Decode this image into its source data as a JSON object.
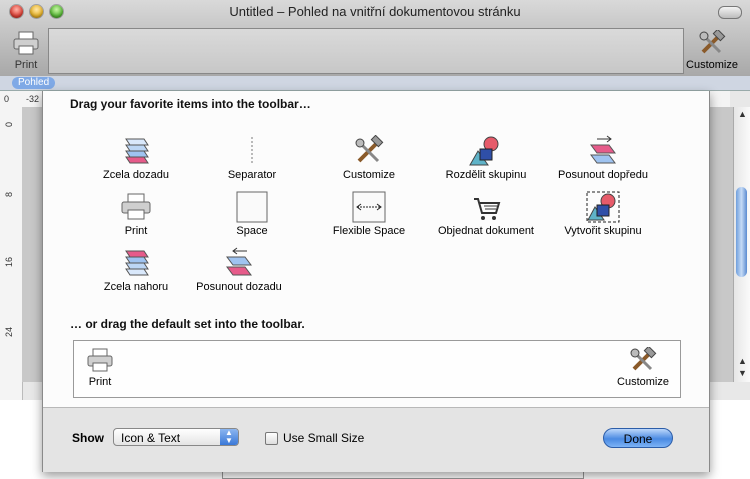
{
  "window": {
    "title": "Untitled – Pohled na vnitřní dokumentovou stránku",
    "toolbar": {
      "print_label": "Print",
      "customize_label": "Customize"
    },
    "doc_tab": "Pohled",
    "ruler": {
      "top_value": "-32",
      "top_value2": "0",
      "left_marks": [
        "0",
        "8",
        "16",
        "24"
      ]
    }
  },
  "sheet": {
    "heading": "Drag your favorite items into the toolbar…",
    "items": [
      {
        "label": "Zcela dozadu",
        "icon": "send-to-back-icon"
      },
      {
        "label": "Separator",
        "icon": "separator-icon"
      },
      {
        "label": "Customize",
        "icon": "customize-tools-icon"
      },
      {
        "label": "Rozdělit skupinu",
        "icon": "ungroup-icon"
      },
      {
        "label": "Posunout dopředu",
        "icon": "bring-forward-icon"
      },
      {
        "label": "Print",
        "icon": "printer-icon"
      },
      {
        "label": "Space",
        "icon": "space-icon"
      },
      {
        "label": "Flexible Space",
        "icon": "flexible-space-icon"
      },
      {
        "label": "Objednat dokument",
        "icon": "shopping-cart-icon"
      },
      {
        "label": "Vytvořit skupinu",
        "icon": "group-icon"
      },
      {
        "label": "Zcela nahoru",
        "icon": "bring-to-front-icon"
      },
      {
        "label": "Posunout dozadu",
        "icon": "send-backward-icon"
      }
    ],
    "default_heading": "… or drag the default set into the toolbar.",
    "default_set": {
      "print_label": "Print",
      "customize_label": "Customize"
    },
    "bottom": {
      "show_label": "Show",
      "show_value": "Icon & Text",
      "small_size_label": "Use Small Size",
      "small_size_checked": false,
      "done_label": "Done"
    }
  },
  "colors": {
    "accent": "#4a8ae2",
    "doc_tab": "#7fa9e6"
  }
}
